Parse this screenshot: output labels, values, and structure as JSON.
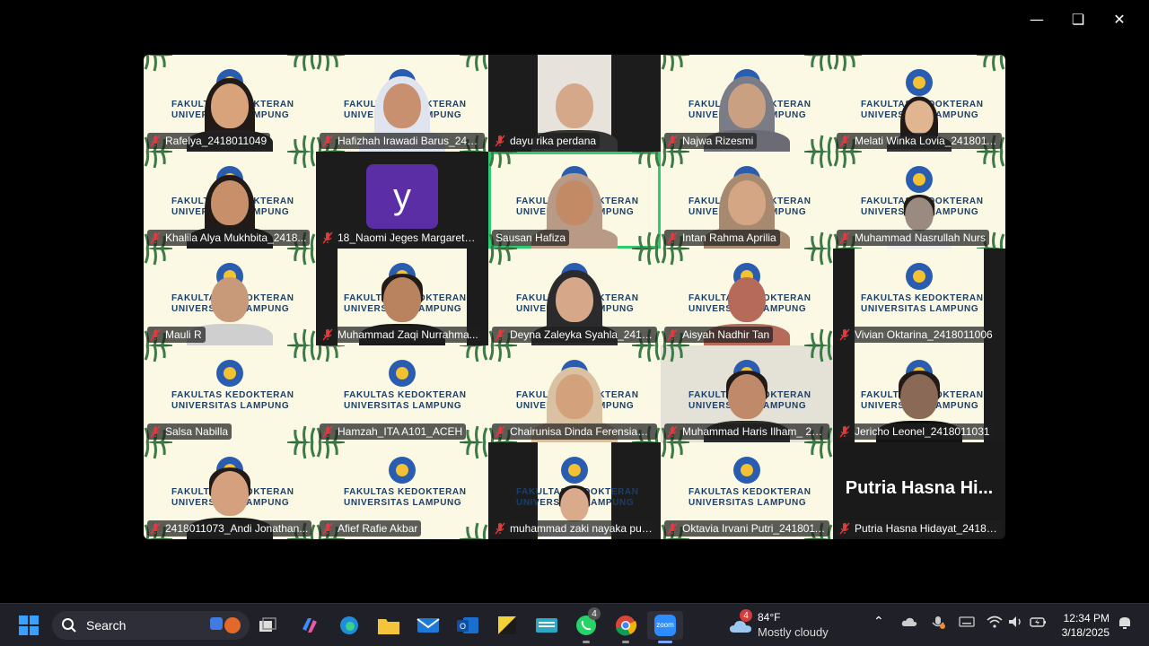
{
  "window": {
    "minimize_icon": "minimize-icon",
    "restore_icon": "restore-icon",
    "close_icon": "close-icon"
  },
  "banner": {
    "line1": "FAKULTAS KEDOKTERAN",
    "line2": "UNIVERSITAS LAMPUNG"
  },
  "participants": [
    {
      "name": "Rafelya_2418011049",
      "muted": true
    },
    {
      "name": "Hafizhah Irawadi Barus_241...",
      "muted": true
    },
    {
      "name": "dayu rika perdana",
      "muted": true
    },
    {
      "name": "Najwa Rizesmi",
      "muted": true
    },
    {
      "name": "Melati Winka Lovia_2418011...",
      "muted": true
    },
    {
      "name": "Khalila Alya Mukhbita_2418...",
      "muted": true
    },
    {
      "name": "18_Naomi Jeges Margaretha...",
      "muted": true,
      "avatar_letter": "y"
    },
    {
      "name": "Sausan Hafiza",
      "muted": false,
      "active_speaker": true
    },
    {
      "name": "Intan Rahma Aprilia",
      "muted": true
    },
    {
      "name": "Muhammad Nasrullah Nurs",
      "muted": true
    },
    {
      "name": "Mauli R",
      "muted": true
    },
    {
      "name": "Muhammad Zaqi Nurrahma...",
      "muted": true
    },
    {
      "name": "Deyna Zaleyka Syahla_24180...",
      "muted": true
    },
    {
      "name": "Aisyah Nadhir Tan",
      "muted": true
    },
    {
      "name": "Vivian Oktarina_2418011006",
      "muted": true
    },
    {
      "name": "Salsa Nabilla",
      "muted": true
    },
    {
      "name": "Hamzah_ITA A101_ACEH",
      "muted": true
    },
    {
      "name": "Chairunisa Dinda Ferensia_2...",
      "muted": true
    },
    {
      "name": "Muhammad Haris Ilham_ 24...",
      "muted": true
    },
    {
      "name": "Jericho Leonel_2418011031",
      "muted": true
    },
    {
      "name": "2418011073_Andi Jonathan...",
      "muted": true
    },
    {
      "name": "Afief Rafie Akbar",
      "muted": true
    },
    {
      "name": "muhammad zaki nayaka put...",
      "muted": true
    },
    {
      "name": "Oktavia Irvani Putri_2418011...",
      "muted": true
    },
    {
      "name": "Putria Hasna Hidayat_24180...",
      "muted": true,
      "video_off_title": "Putria Hasna Hi..."
    }
  ],
  "taskbar": {
    "search_label": "Search",
    "whatsapp_badge": "4",
    "weather_badge": "4",
    "temperature": "84°F",
    "weather_condition": "Mostly cloudy",
    "time": "12:34 PM",
    "date": "3/18/2025",
    "zoom_label": "zoom"
  },
  "colors": {
    "active_speaker_border": "#2ecc71",
    "tile_background": "#fbf9e4",
    "mute_red": "#e0393e",
    "taskbar_bg": "#202028"
  }
}
